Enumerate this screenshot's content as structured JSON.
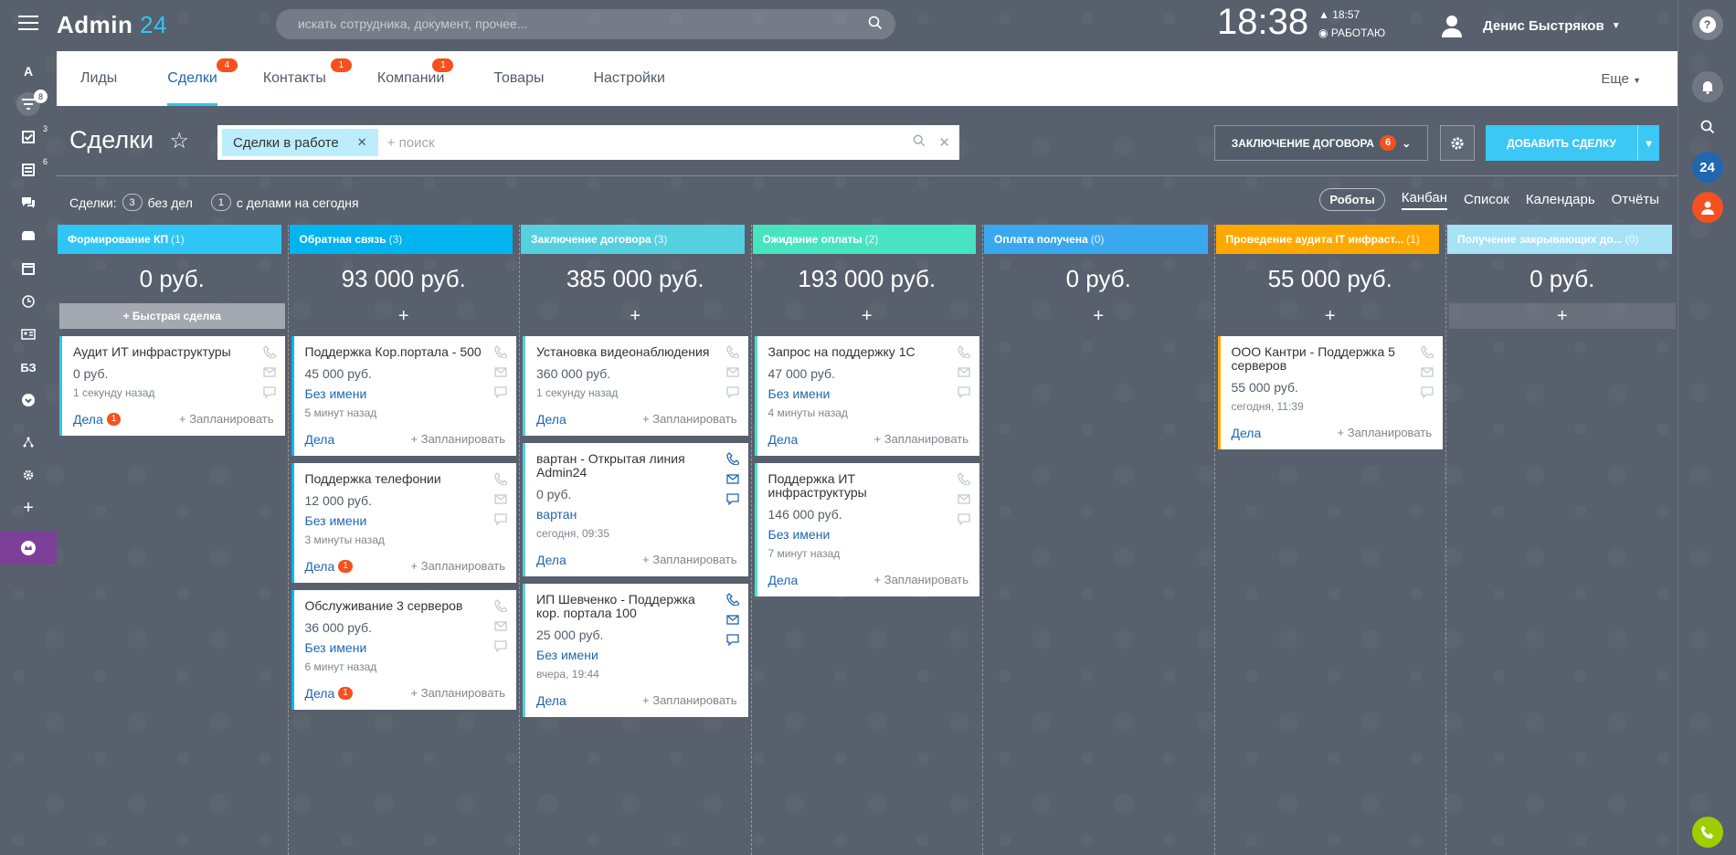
{
  "header": {
    "logo_text": "Admin",
    "logo_num": "24",
    "search_placeholder": "искать сотрудника, документ, прочее...",
    "clock": "18:38",
    "alarm": "18:57",
    "status": "РАБОТАЮ",
    "user_name": "Денис Быстряков"
  },
  "left_bar": {
    "items": [
      {
        "name": "a-icon",
        "label": "A"
      },
      {
        "name": "filter-icon",
        "badge": "8"
      },
      {
        "name": "tasks-icon",
        "badge": "3"
      },
      {
        "name": "feed-icon",
        "badge": "6"
      },
      {
        "name": "chat-icon"
      },
      {
        "name": "drive-icon"
      },
      {
        "name": "calendar-icon"
      },
      {
        "name": "clock-icon"
      },
      {
        "name": "contacts-icon"
      },
      {
        "name": "kb-icon",
        "label": "БЗ"
      },
      {
        "name": "more-icon"
      },
      {
        "name": "sitemap-icon"
      },
      {
        "name": "settings-icon"
      },
      {
        "name": "plus-icon",
        "label": "+"
      }
    ]
  },
  "tabs": [
    {
      "label": "Лиды",
      "badge": ""
    },
    {
      "label": "Сделки",
      "badge": "4"
    },
    {
      "label": "Контакты",
      "badge": "1"
    },
    {
      "label": "Компании",
      "badge": "1"
    },
    {
      "label": "Товары",
      "badge": ""
    },
    {
      "label": "Настройки",
      "badge": ""
    }
  ],
  "more_tab": "Еще",
  "page": {
    "title": "Сделки",
    "filter_chip": "Сделки в работе",
    "filter_placeholder": "+ поиск",
    "stage_button": "ЗАКЛЮЧЕНИЕ ДОГОВОРА",
    "stage_count": "6",
    "add_button": "ДОБАВИТЬ СДЕЛКУ",
    "counters_label": "Сделки:",
    "counter1": "3",
    "counter1_text": "без дел",
    "counter2": "1",
    "counter2_text": "с делами на сегодня",
    "robots": "Роботы",
    "views": [
      "Канбан",
      "Список",
      "Календарь",
      "Отчёты"
    ]
  },
  "right_bar": {
    "badge_24": "24",
    "help": "?"
  },
  "columns": [
    {
      "title": "Формирование КП",
      "count": "(1)",
      "sum": "0 руб.",
      "color": "#2fc6f6",
      "quick": "+ Быстрая сделка",
      "cards": [
        {
          "title": "Аудит ИТ инфраструктуры",
          "price": "0 руб.",
          "contact": "",
          "time": "1 секунду назад",
          "deals": "Дела",
          "badge": "1",
          "plan": "+ Запланировать"
        }
      ]
    },
    {
      "title": "Обратная связь",
      "count": "(3)",
      "sum": "93 000 руб.",
      "color": "#00b4f0",
      "cards": [
        {
          "title": "Поддержка Кор.портала - 500",
          "price": "45 000 руб.",
          "contact": "Без имени",
          "time": "5 минут назад",
          "deals": "Дела",
          "badge": "",
          "plan": "+ Запланировать"
        },
        {
          "title": "Поддержка телефонии",
          "price": "12 000 руб.",
          "contact": "Без имени",
          "time": "3 минуты назад",
          "deals": "Дела",
          "badge": "1",
          "plan": "+ Запланировать"
        },
        {
          "title": "Обслуживание 3 серверов",
          "price": "36 000 руб.",
          "contact": "Без имени",
          "time": "6 минут назад",
          "deals": "Дела",
          "badge": "1",
          "plan": "+ Запланировать"
        }
      ]
    },
    {
      "title": "Заключение договора",
      "count": "(3)",
      "sum": "385 000 руб.",
      "color": "#55d0e0",
      "cards": [
        {
          "title": "Установка видеонаблюдения",
          "price": "360 000 руб.",
          "contact": "",
          "time": "1 секунду назад",
          "deals": "Дела",
          "badge": "",
          "plan": "+ Запланировать"
        },
        {
          "title": "вартан - Открытая линия Admin24",
          "price": "0 руб.",
          "contact": "вартан",
          "time": "сегодня, 09:35",
          "deals": "Дела",
          "badge": "",
          "plan": "+ Запланировать"
        },
        {
          "title": "ИП Шевченко - Поддержка кор. портала 100",
          "price": "25 000 руб.",
          "contact": "Без имени",
          "time": "вчера, 19:44",
          "deals": "Дела",
          "badge": "",
          "plan": "+ Запланировать"
        }
      ]
    },
    {
      "title": "Ожидание оплаты",
      "count": "(2)",
      "sum": "193 000 руб.",
      "color": "#47e4c2",
      "cards": [
        {
          "title": "Запрос на поддержку 1С",
          "price": "47 000 руб.",
          "contact": "Без имени",
          "time": "4 минуты назад",
          "deals": "Дела",
          "badge": "",
          "plan": "+ Запланировать"
        },
        {
          "title": "Поддержка ИТ инфраструктуры",
          "price": "146 000 руб.",
          "contact": "Без имени",
          "time": "7 минут назад",
          "deals": "Дела",
          "badge": "",
          "plan": "+ Запланировать"
        }
      ]
    },
    {
      "title": "Оплата получена",
      "count": "(0)",
      "sum": "0 руб.",
      "color": "#39a8ef",
      "cards": []
    },
    {
      "title": "Проведение аудита IT инфраст...",
      "count": "(1)",
      "sum": "55 000 руб.",
      "color": "#ffa900",
      "cards": [
        {
          "title": "ООО Кантри - Поддержка 5 серверов",
          "price": "55 000 руб.",
          "contact": "",
          "time": "сегодня, 11:39",
          "deals": "Дела",
          "badge": "",
          "plan": "+ Запланировать"
        }
      ]
    },
    {
      "title": "Получение закрывающих до...",
      "count": "(0)",
      "sum": "0 руб.",
      "color": "#a6e3f7",
      "cards": []
    }
  ]
}
